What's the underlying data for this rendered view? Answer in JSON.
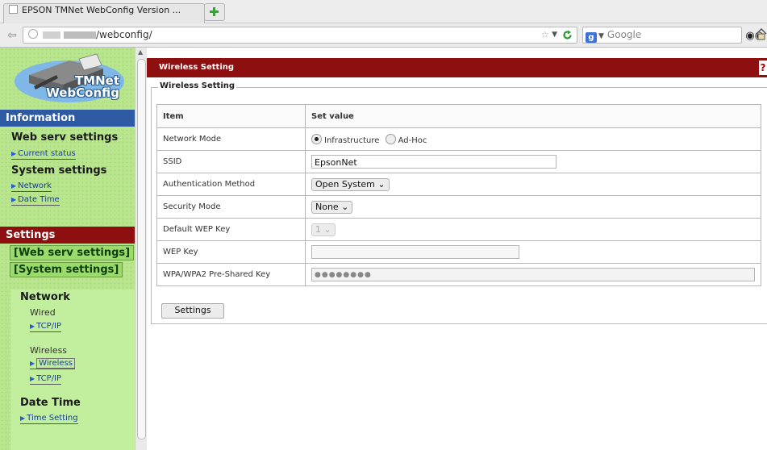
{
  "browser": {
    "tab_title": "EPSON TMNet WebConfig Version ...",
    "url": "/webconfig/",
    "search_placeholder": "Google"
  },
  "sidebar": {
    "logo_line1": "TMNet",
    "logo_line2": "WebConfig",
    "information": {
      "header": "Information",
      "web_serv": "Web serv settings",
      "current_status": "Current status",
      "system_settings": "System settings",
      "network": "Network",
      "date_time": "Date Time"
    },
    "settings": {
      "header": "Settings",
      "web_serv_btn": "[Web serv settings]",
      "system_btn": "[System settings]",
      "network_head": "Network",
      "wired": "Wired",
      "wired_tcpip": "TCP/IP",
      "wireless": "Wireless",
      "wireless_link": "Wireless",
      "wireless_tcpip": "TCP/IP",
      "date_time_head": "Date Time",
      "time_setting": "Time Setting"
    }
  },
  "main": {
    "banner": "Wireless Setting",
    "help": "?",
    "legend": "Wireless Setting",
    "table": {
      "col_item": "Item",
      "col_value": "Set value",
      "network_mode_label": "Network Mode",
      "network_mode_opt1": "Infrastructure",
      "network_mode_opt2": "Ad-Hoc",
      "ssid_label": "SSID",
      "ssid_value": "EpsonNet",
      "auth_label": "Authentication Method",
      "auth_value": "Open System",
      "security_label": "Security Mode",
      "security_value": "None",
      "wep_default_label": "Default WEP Key",
      "wep_default_value": "1",
      "wep_key_label": "WEP Key",
      "wep_key_value": "",
      "wpa_label": "WPA/WPA2 Pre-Shared Key",
      "wpa_value": "●●●●●●●●"
    },
    "settings_button": "Settings"
  }
}
